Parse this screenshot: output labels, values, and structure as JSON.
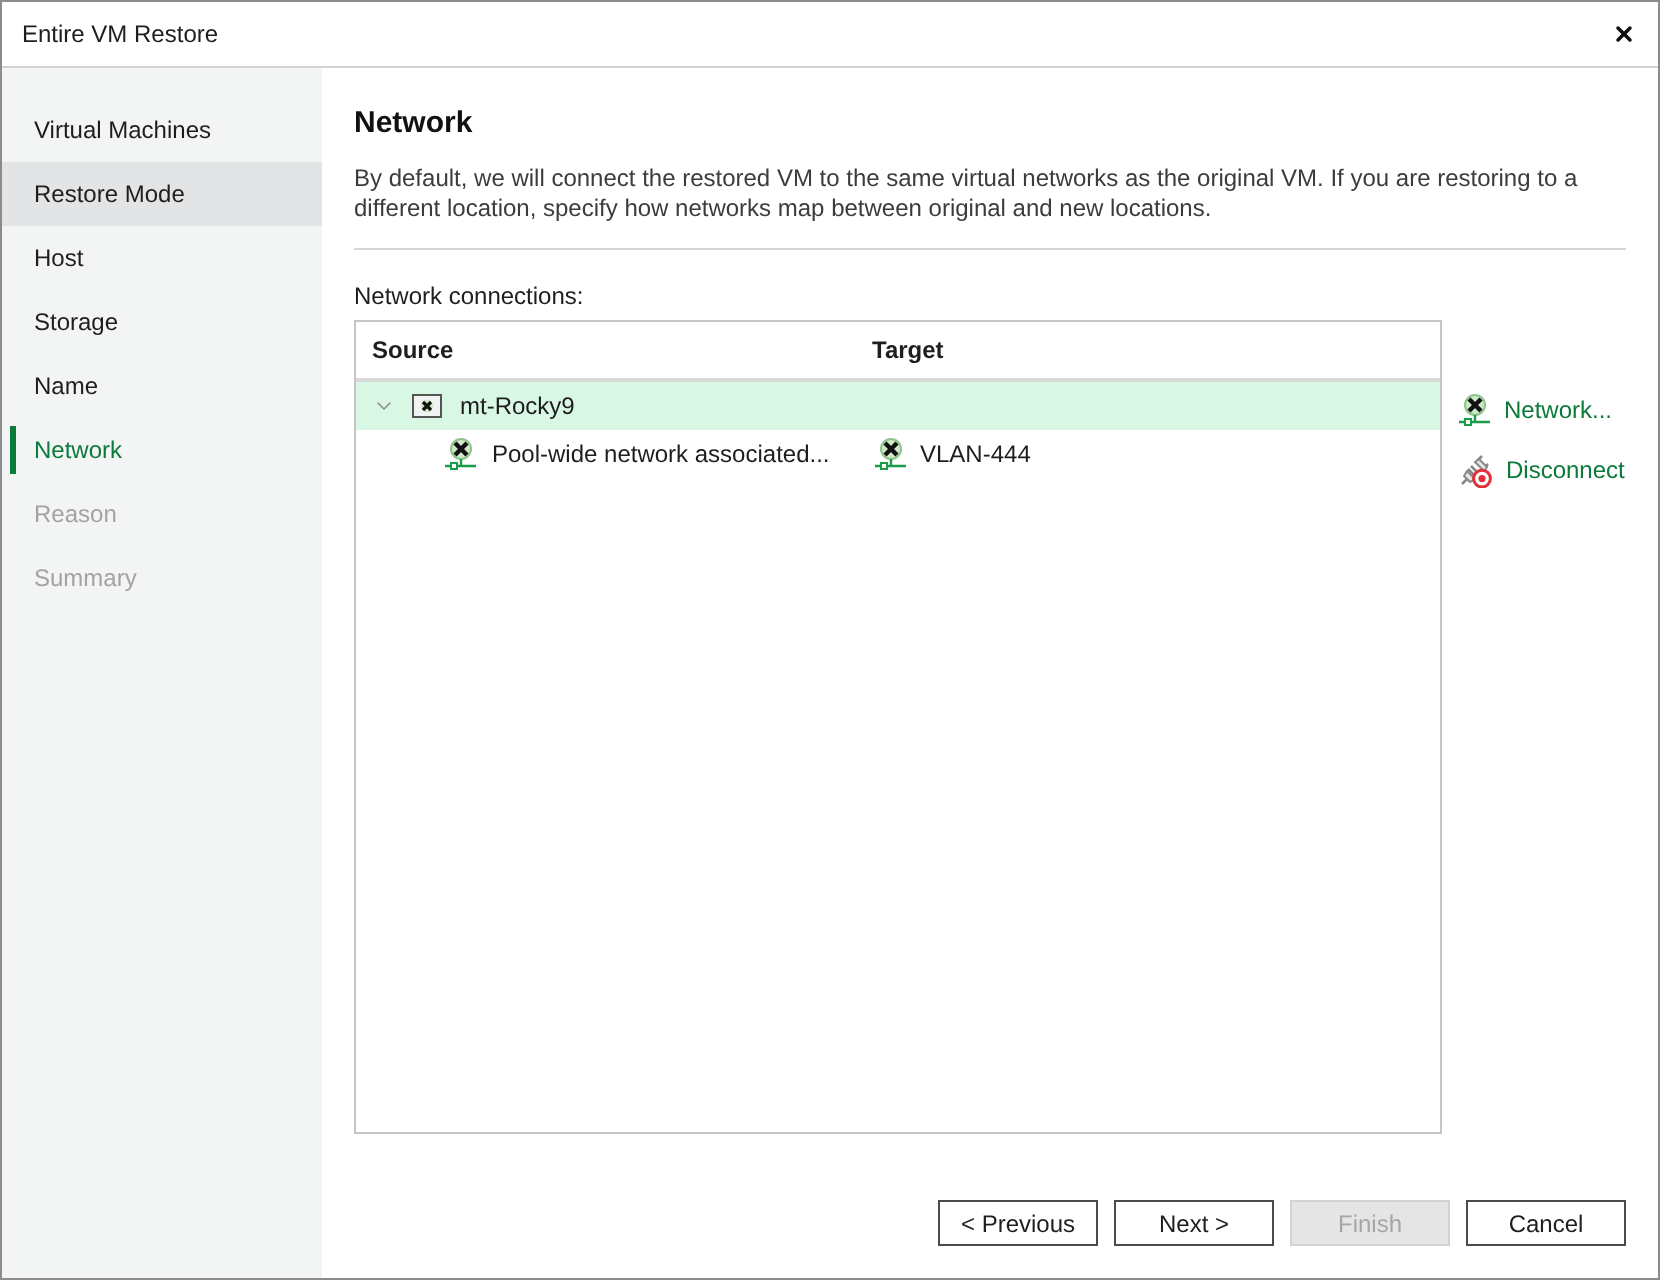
{
  "window": {
    "title": "Entire VM Restore"
  },
  "sidebar": {
    "items": [
      {
        "label": "Virtual Machines",
        "selected": false,
        "hovered": false,
        "disabled": false
      },
      {
        "label": "Restore Mode",
        "selected": false,
        "hovered": true,
        "disabled": false
      },
      {
        "label": "Host",
        "selected": false,
        "hovered": false,
        "disabled": false
      },
      {
        "label": "Storage",
        "selected": false,
        "hovered": false,
        "disabled": false
      },
      {
        "label": "Name",
        "selected": false,
        "hovered": false,
        "disabled": false
      },
      {
        "label": "Network",
        "selected": true,
        "hovered": false,
        "disabled": false
      },
      {
        "label": "Reason",
        "selected": false,
        "hovered": false,
        "disabled": true
      },
      {
        "label": "Summary",
        "selected": false,
        "hovered": false,
        "disabled": true
      }
    ]
  },
  "page": {
    "title": "Network",
    "description": "By default, we will connect the restored VM to the same virtual networks as the original VM. If you are restoring to a different location, specify how networks map between original and new locations."
  },
  "connections": {
    "label": "Network connections:",
    "columns": [
      "Source",
      "Target"
    ],
    "rows": [
      {
        "source": "mt-Rocky9",
        "expanded": true,
        "selected": true,
        "children": [
          {
            "source": "Pool-wide network associated...",
            "target": "VLAN-444",
            "selected": false
          }
        ]
      }
    ]
  },
  "actions": [
    {
      "label": "Network...",
      "kind": "network"
    },
    {
      "label": "Disconnect",
      "kind": "disconnect"
    }
  ],
  "buttons": [
    {
      "label": "< Previous",
      "disabled": false
    },
    {
      "label": "Next >",
      "disabled": false
    },
    {
      "label": "Finish",
      "disabled": true
    },
    {
      "label": "Cancel",
      "disabled": false
    }
  ]
}
